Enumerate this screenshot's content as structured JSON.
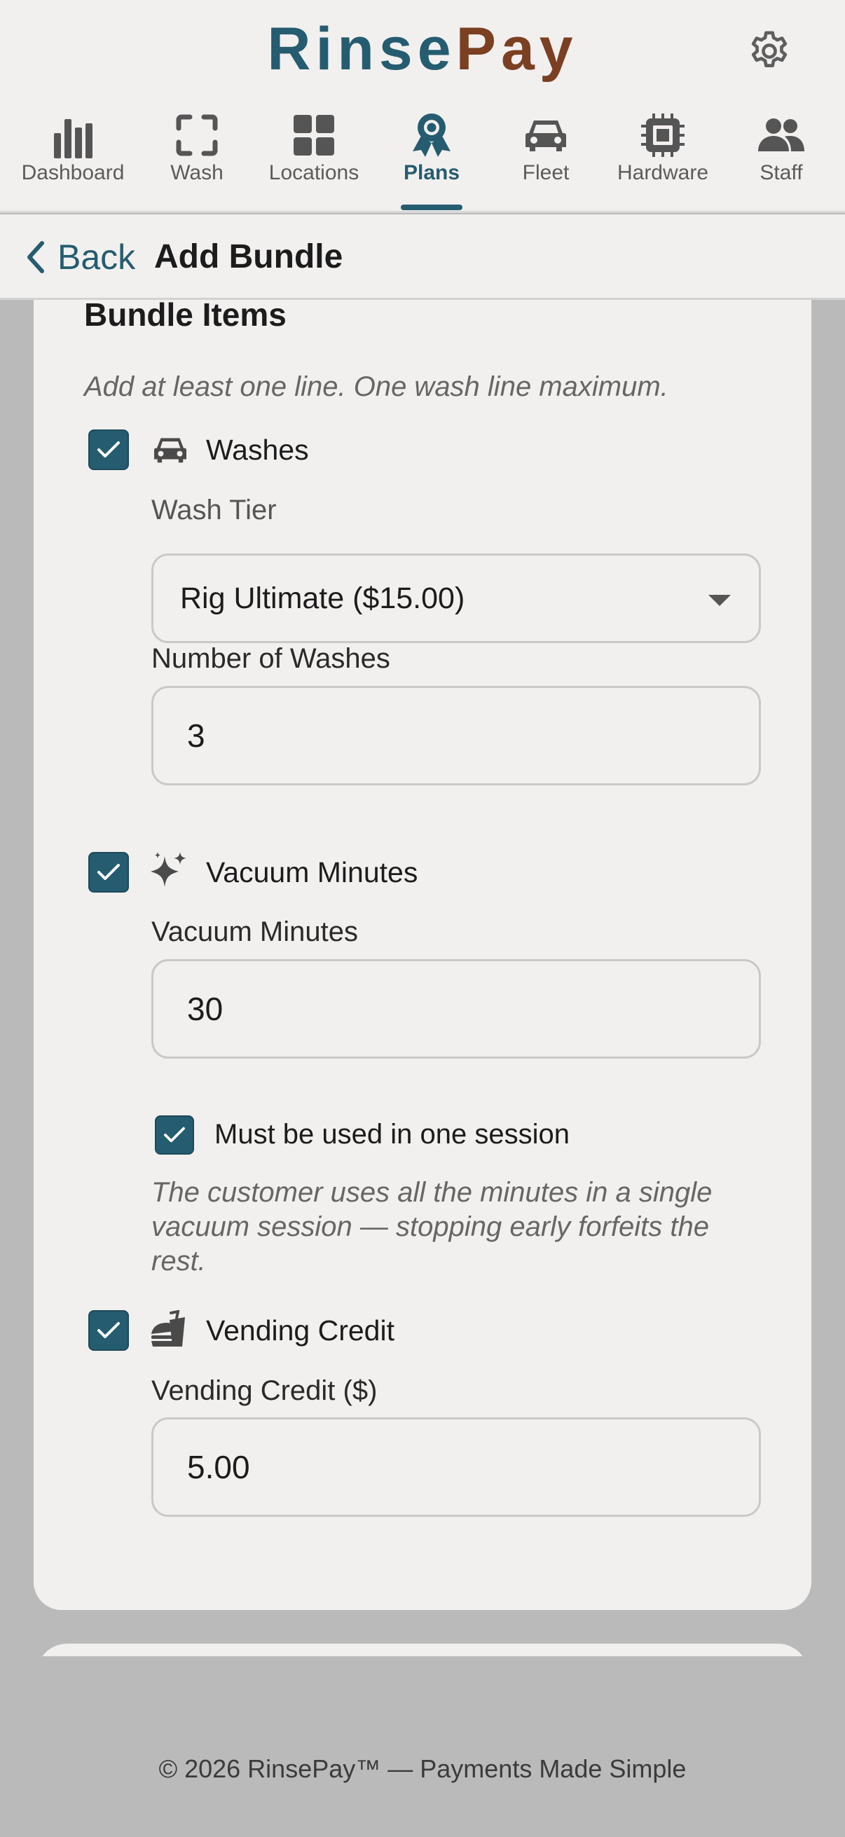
{
  "brand": {
    "part1": "Rinse",
    "part2": "Pay"
  },
  "colors": {
    "accent": "#255c70",
    "brand_secondary": "#7b3f22",
    "background": "#bababa",
    "surface": "#f2f0ef"
  },
  "header": {
    "settings_icon": "gear-icon"
  },
  "nav": {
    "active": "Plans",
    "items": [
      {
        "label": "Dashboard",
        "icon": "bar-chart-icon"
      },
      {
        "label": "Wash",
        "icon": "scan-frame-icon"
      },
      {
        "label": "Locations",
        "icon": "grid-icon"
      },
      {
        "label": "Plans",
        "icon": "award-ribbon-icon"
      },
      {
        "label": "Fleet",
        "icon": "car-icon"
      },
      {
        "label": "Hardware",
        "icon": "chip-icon"
      },
      {
        "label": "Staff",
        "icon": "people-icon"
      }
    ]
  },
  "subheader": {
    "back_label": "Back",
    "title": "Add Bundle"
  },
  "bundle": {
    "section_title": "Bundle Items",
    "hint": "Add at least one line. One wash line maximum.",
    "washes": {
      "checked": true,
      "icon": "car-icon",
      "label": "Washes",
      "tier_label": "Wash Tier",
      "tier_value": "Rig Ultimate ($15.00)",
      "count_label": "Number of Washes",
      "count_value": "3"
    },
    "vacuum": {
      "checked": true,
      "icon": "sparkles-icon",
      "label": "Vacuum Minutes",
      "minutes_label": "Vacuum Minutes",
      "minutes_value": "30",
      "single_session_checked": true,
      "single_session_label": "Must be used in one session",
      "single_session_help": "The customer uses all the minutes in a single vacuum session — stopping early forfeits the rest."
    },
    "vending": {
      "checked": true,
      "icon": "snack-icon",
      "label": "Vending Credit",
      "credit_label": "Vending Credit ($)",
      "credit_value": "5.00"
    }
  },
  "footer": {
    "text": "© 2026 RinsePay™ — Payments Made Simple"
  }
}
